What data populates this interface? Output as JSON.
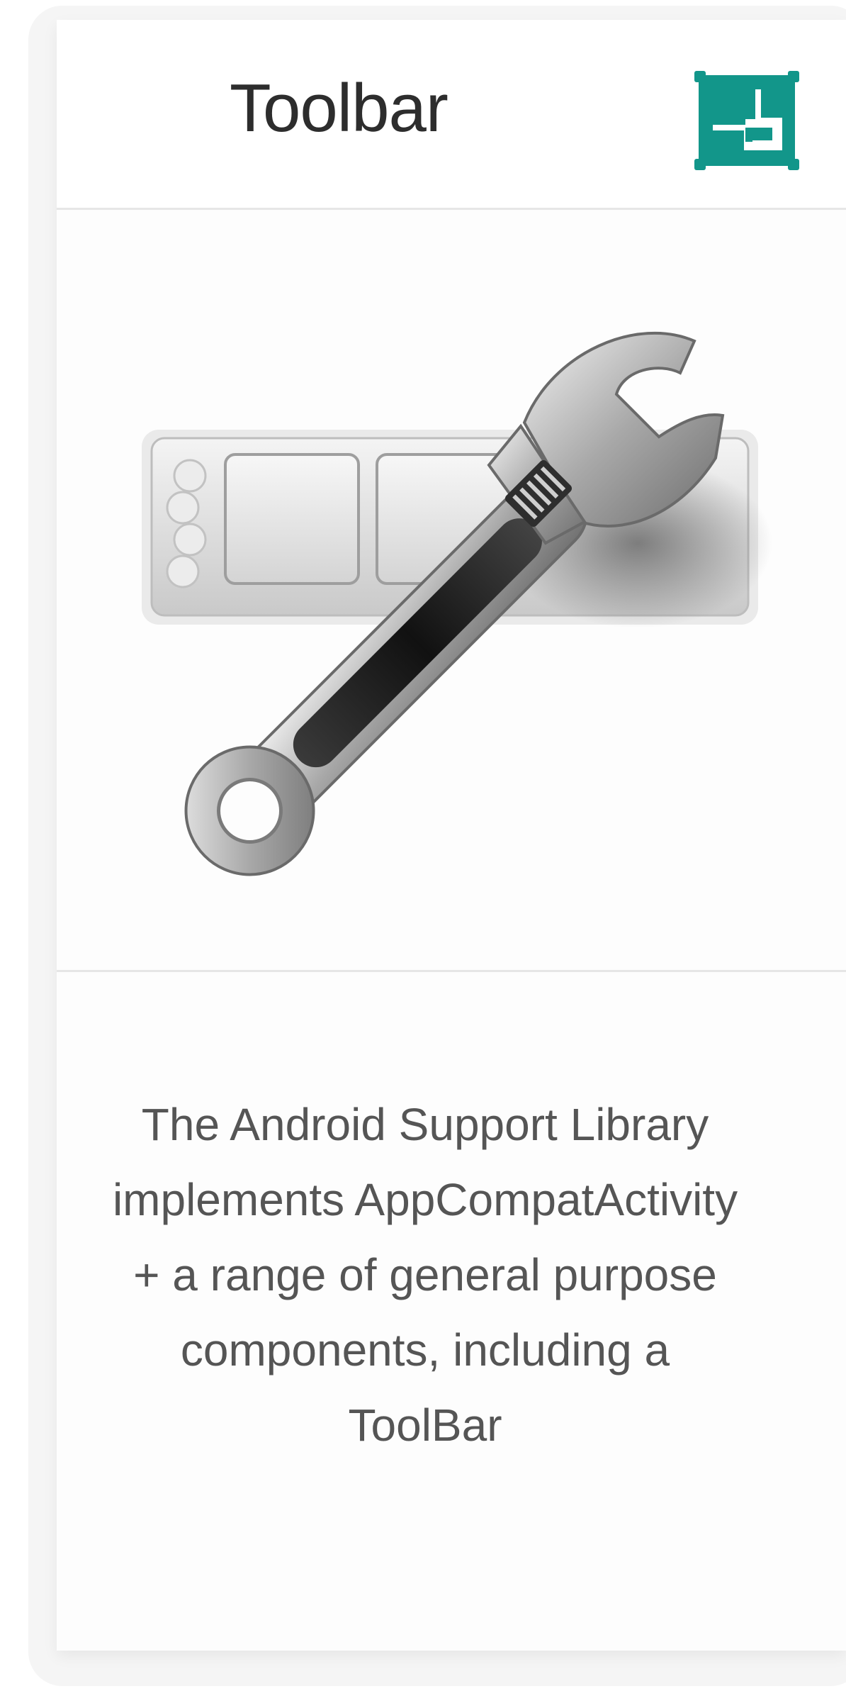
{
  "card": {
    "title": "Toolbar",
    "description": "The Android Support Library implements AppCompatActivity + a range of general purpose components, including a ToolBar"
  },
  "icons": {
    "header_action": "open-in-window-icon",
    "illustration": "toolbar-wrench-icon"
  },
  "colors": {
    "accent": "#12968a",
    "title_text": "#2d2d2d",
    "body_text": "#555555"
  }
}
